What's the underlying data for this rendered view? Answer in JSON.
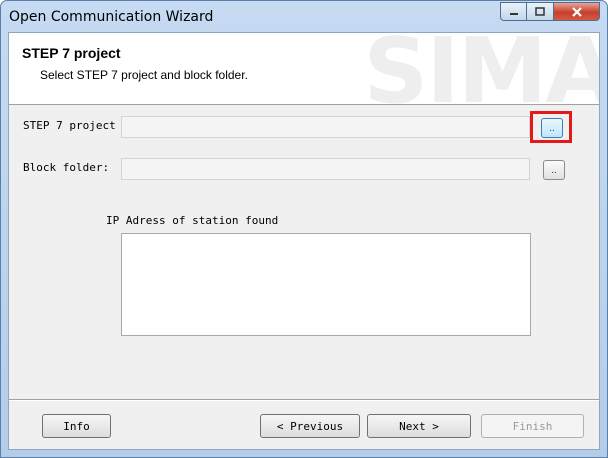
{
  "window": {
    "title": "Open Communication Wizard"
  },
  "header": {
    "title": "STEP 7 project",
    "subtitle": "Select STEP 7 project and block folder.",
    "watermark": "SIMA"
  },
  "form": {
    "project_label": "STEP 7 project",
    "project_value": "",
    "project_browse": "..",
    "folder_label": "Block folder:",
    "folder_value": "",
    "folder_browse": "..",
    "ip_list_label": "IP Adress of station found",
    "ip_list_items": []
  },
  "buttons": {
    "info": "Info",
    "previous": "< Previous",
    "next": "Next >",
    "finish": "Finish"
  },
  "colors": {
    "highlight": "#e11b1b"
  }
}
